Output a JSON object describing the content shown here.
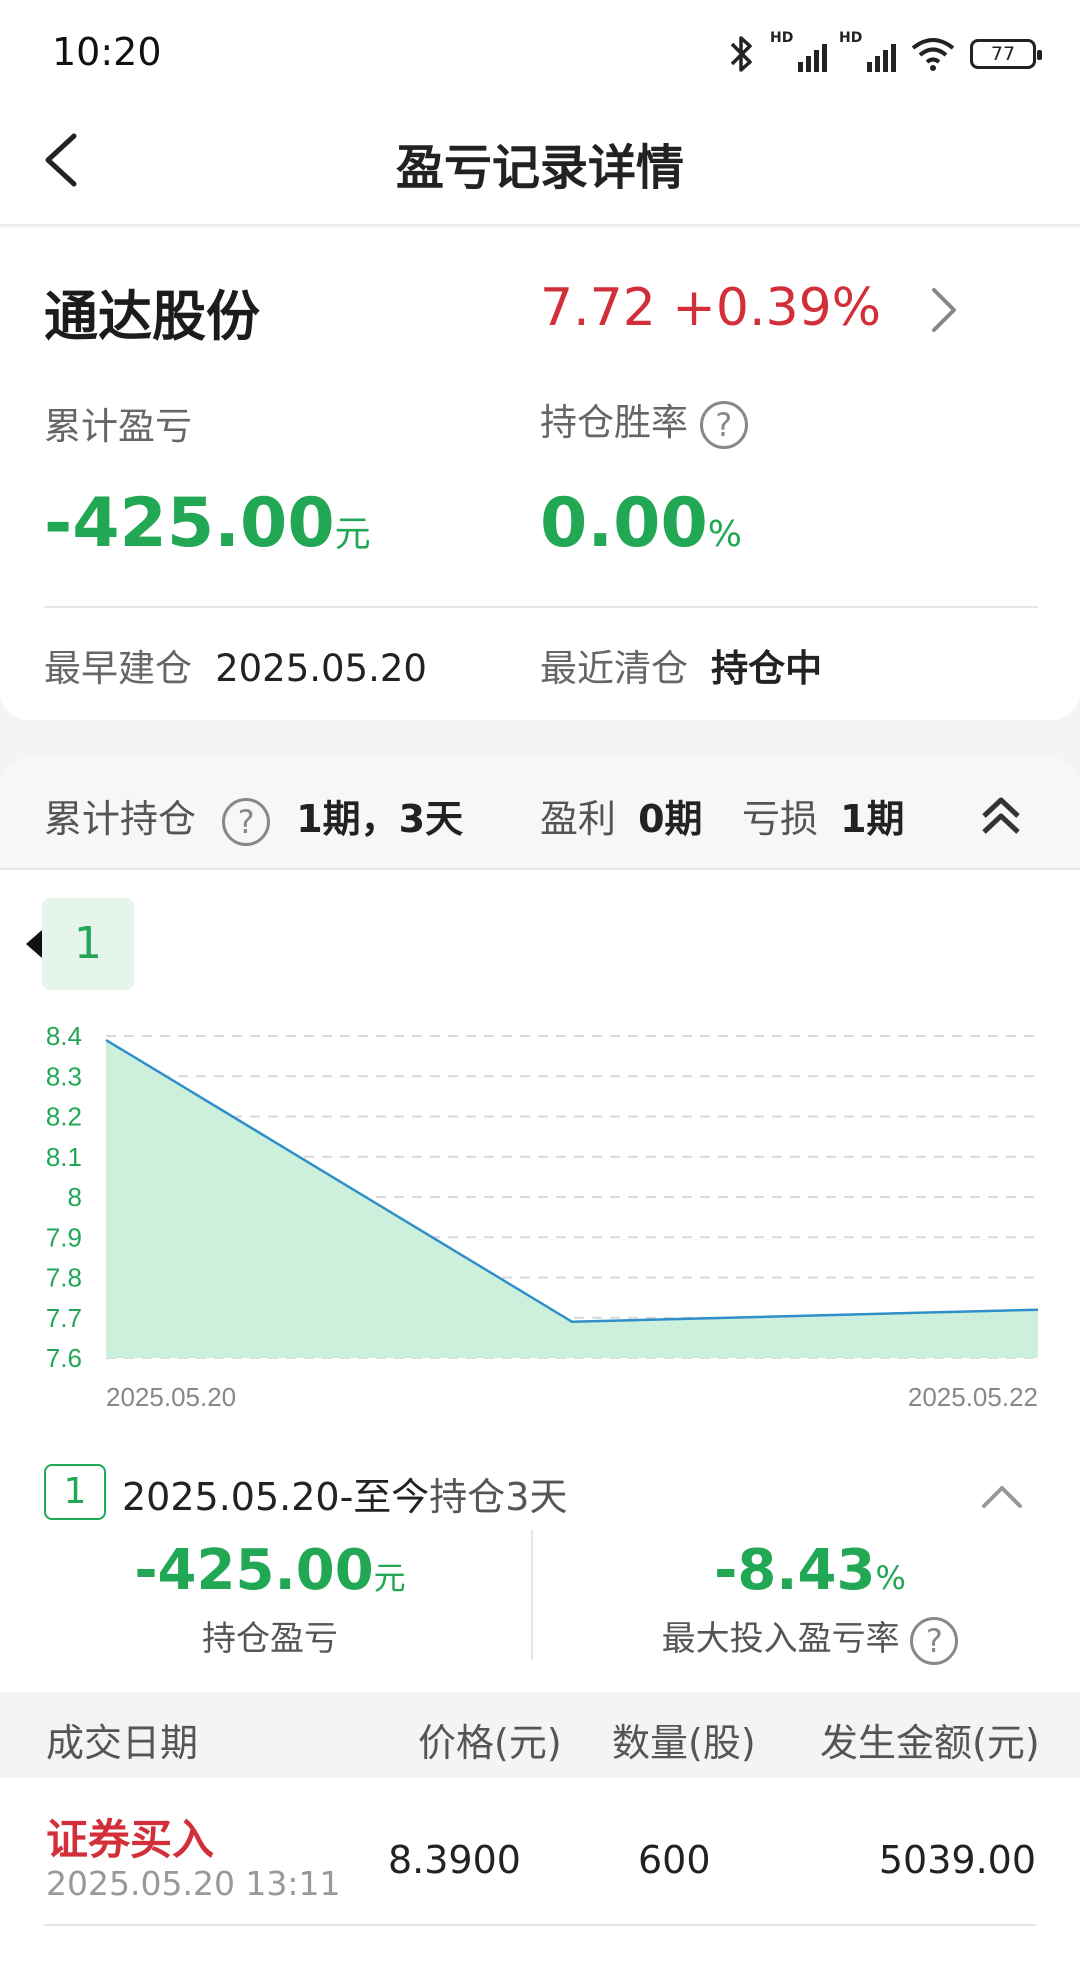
{
  "status_bar": {
    "time": "10:20",
    "signal_labels": [
      "HD",
      "HD"
    ],
    "battery": "77"
  },
  "nav": {
    "title": "盈亏记录详情"
  },
  "stock": {
    "name": "通达股份",
    "quote": "7.72 +0.39%"
  },
  "summary": {
    "cum_pnl_label": "累计盈亏",
    "cum_pnl_value": "-425.00",
    "cum_pnl_unit": "元",
    "win_rate_label": "持仓胜率",
    "win_rate_value": "0.00",
    "win_rate_unit": "%",
    "first_open_label": "最早建仓",
    "first_open_value": "2025.05.20",
    "last_clear_label": "最近清仓",
    "last_clear_value": "持仓中"
  },
  "position": {
    "cum_hold_label": "累计持仓",
    "cum_hold_value": "1期，3天",
    "profit_label": "盈利",
    "profit_value": "0期",
    "loss_label": "亏损",
    "loss_value": "1期",
    "period_tab": "1"
  },
  "colors": {
    "up_red": "#d32f3a",
    "down_green": "#22a754",
    "line_blue": "#2e8fc9",
    "area_fill": "#cdf0dc"
  },
  "chart_data": {
    "type": "area",
    "x": [
      "2025.05.20",
      "2025.05.21",
      "2025.05.22"
    ],
    "values": [
      8.39,
      7.69,
      7.72
    ],
    "x_tick_labels": [
      "2025.05.20",
      "2025.05.22"
    ],
    "y_ticks": [
      "8.4",
      "8.3",
      "8.2",
      "8.1",
      "8",
      "7.9",
      "7.8",
      "7.7",
      "7.6"
    ],
    "ylim": [
      7.6,
      8.4
    ],
    "grid": true
  },
  "period": {
    "badge": "1",
    "range": "2025.05.20-至今",
    "hold_text": "持仓3天",
    "pnl_value": "-425.00",
    "pnl_unit": "元",
    "pnl_label": "持仓盈亏",
    "rate_value": "-8.43",
    "rate_unit": "%",
    "rate_label": "最大投入盈亏率"
  },
  "trades": {
    "headers": [
      "成交日期",
      "价格(元)",
      "数量(股)",
      "发生金额(元)"
    ],
    "rows": [
      {
        "type": "证券买入",
        "time": "2025.05.20 13:11",
        "price": "8.3900",
        "qty": "600",
        "amount": "5039.00"
      }
    ]
  }
}
